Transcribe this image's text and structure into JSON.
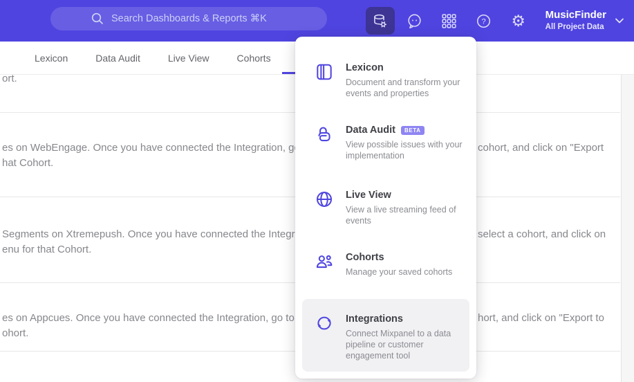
{
  "colors": {
    "accent": "#4f44e0",
    "active_button_bg": "#3d3494",
    "badge_bg": "#8f85f2",
    "menu_icon": "#4f46e0"
  },
  "topbar": {
    "search_placeholder": "Search Dashboards & Reports ⌘K",
    "project_name": "MusicFinder",
    "project_scope": "All Project Data"
  },
  "tabs": [
    {
      "label": "Lexicon"
    },
    {
      "label": "Data Audit"
    },
    {
      "label": "Live View"
    },
    {
      "label": "Cohorts"
    }
  ],
  "menu": {
    "items": [
      {
        "title": "Lexicon",
        "desc": "Document and transform your events and properties"
      },
      {
        "title": "Data Audit",
        "badge": "BETA",
        "desc": "View possible issues with your implementation"
      },
      {
        "title": "Live View",
        "desc": "View a live streaming feed of events"
      },
      {
        "title": "Cohorts",
        "desc": "Manage your saved cohorts"
      },
      {
        "title": "Integrations",
        "desc": "Connect Mixpanel to a data pipeline or customer engagement tool"
      }
    ]
  },
  "content": {
    "rows": [
      {
        "line1_left": "ort."
      },
      {
        "line1_left": "es on WebEngage. Once you have connected the Integration, go to the",
        "line1_right": "cohort, and click on \"Export",
        "line2_left": "hat Cohort."
      },
      {
        "line1_left": "Segments on Xtremepush. Once you have connected the Integration,",
        "line1_right": "select a cohort, and click on",
        "line2_left": "enu for that Cohort."
      },
      {
        "line1_left": "es on Appcues. Once you have connected the Integration, go to the M",
        "line1_right": "hort, and click on \"Export to",
        "line2_left": "ohort."
      }
    ]
  }
}
